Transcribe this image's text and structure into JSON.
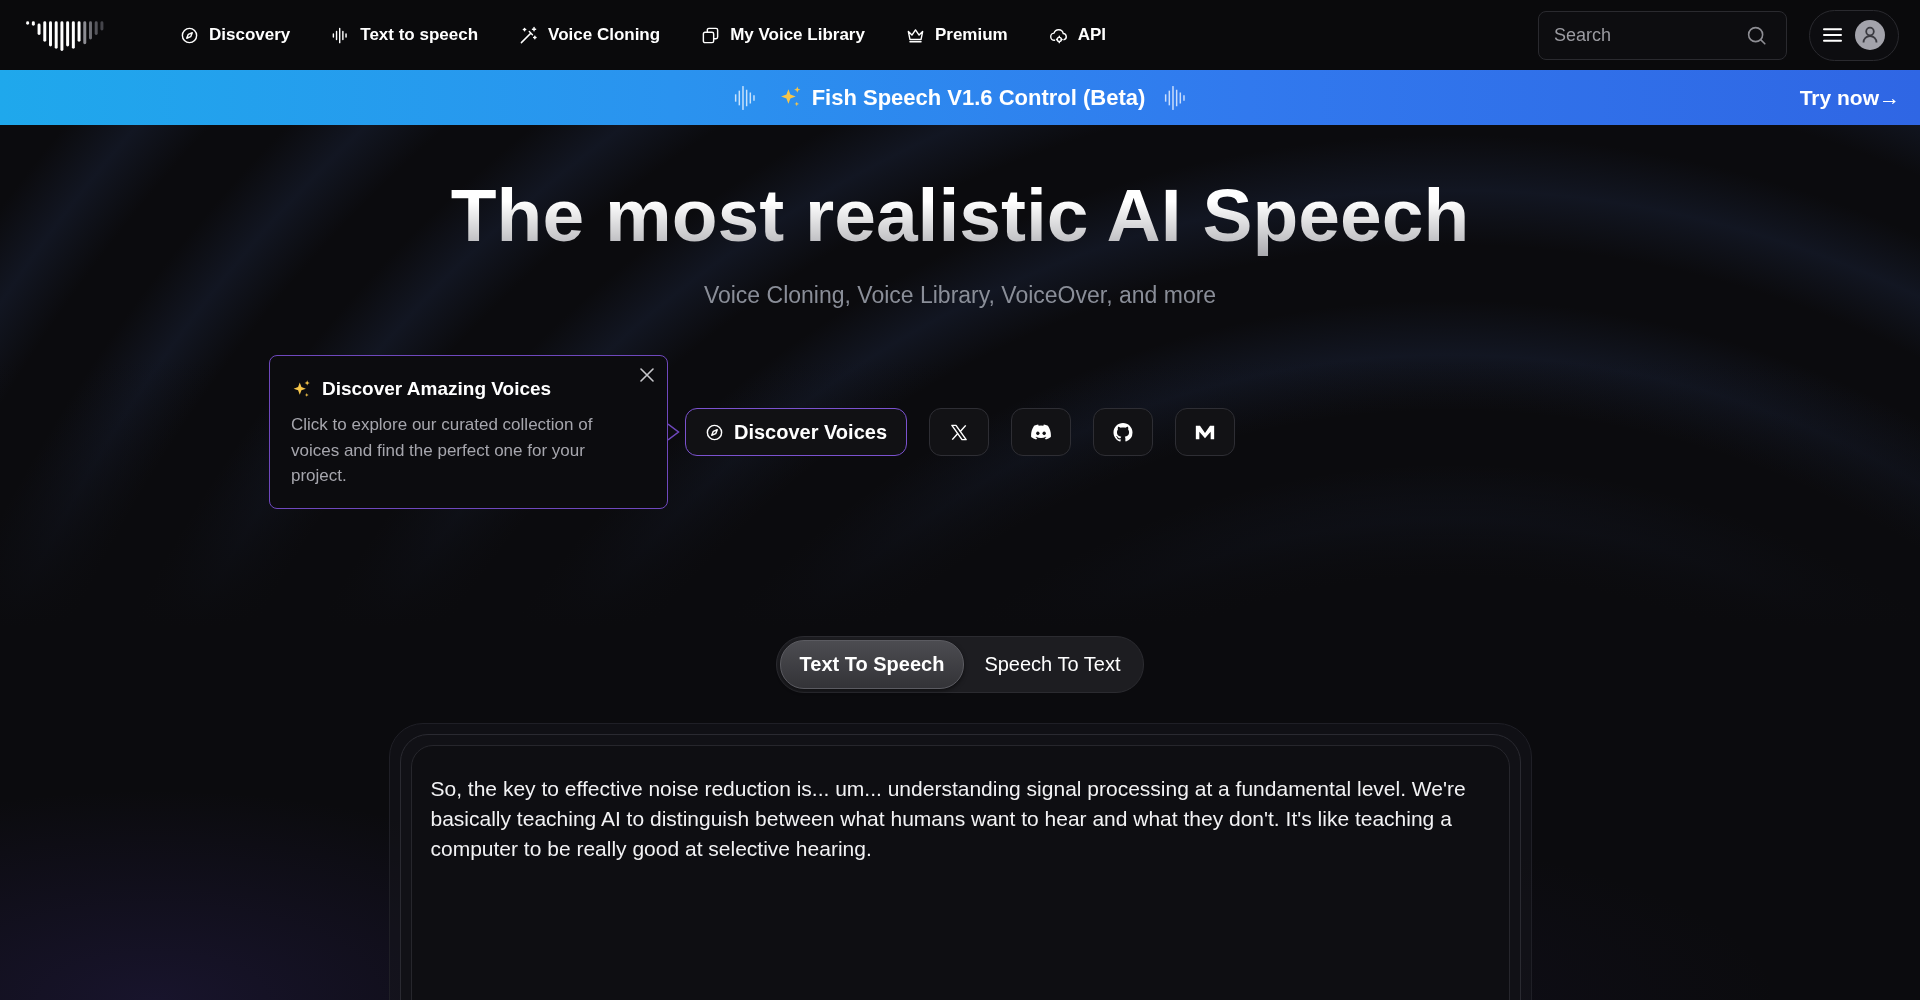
{
  "header": {
    "nav_items": [
      "Discovery",
      "Text to speech",
      "Voice Cloning",
      "My Voice Library",
      "Premium",
      "API"
    ],
    "search": {
      "placeholder": "Search"
    }
  },
  "announcement": {
    "title": "Fish Speech V1.6 Control (Beta)",
    "link": "Try now→"
  },
  "hero": {
    "title": "The most realistic AI Speech",
    "subtitle": "Voice Cloning, Voice Library, VoiceOver, and more"
  },
  "tooltip": {
    "title": "Discover Amazing Voices",
    "body": "Click to explore our curated collection of voices and find the perfect one for your project."
  },
  "cta_button": "Discover Voices",
  "mode_tabs": [
    {
      "label": "Text To Speech",
      "selected": true
    },
    {
      "label": "Speech To Text",
      "selected": false
    }
  ],
  "editor": {
    "value": "So, the key to effective noise reduction is... um... understanding signal processing at a fundamental level. We're basically teaching AI to distinguish between what humans want to hear and what they don't. It's like teaching a computer to be really good at selective hearing."
  }
}
